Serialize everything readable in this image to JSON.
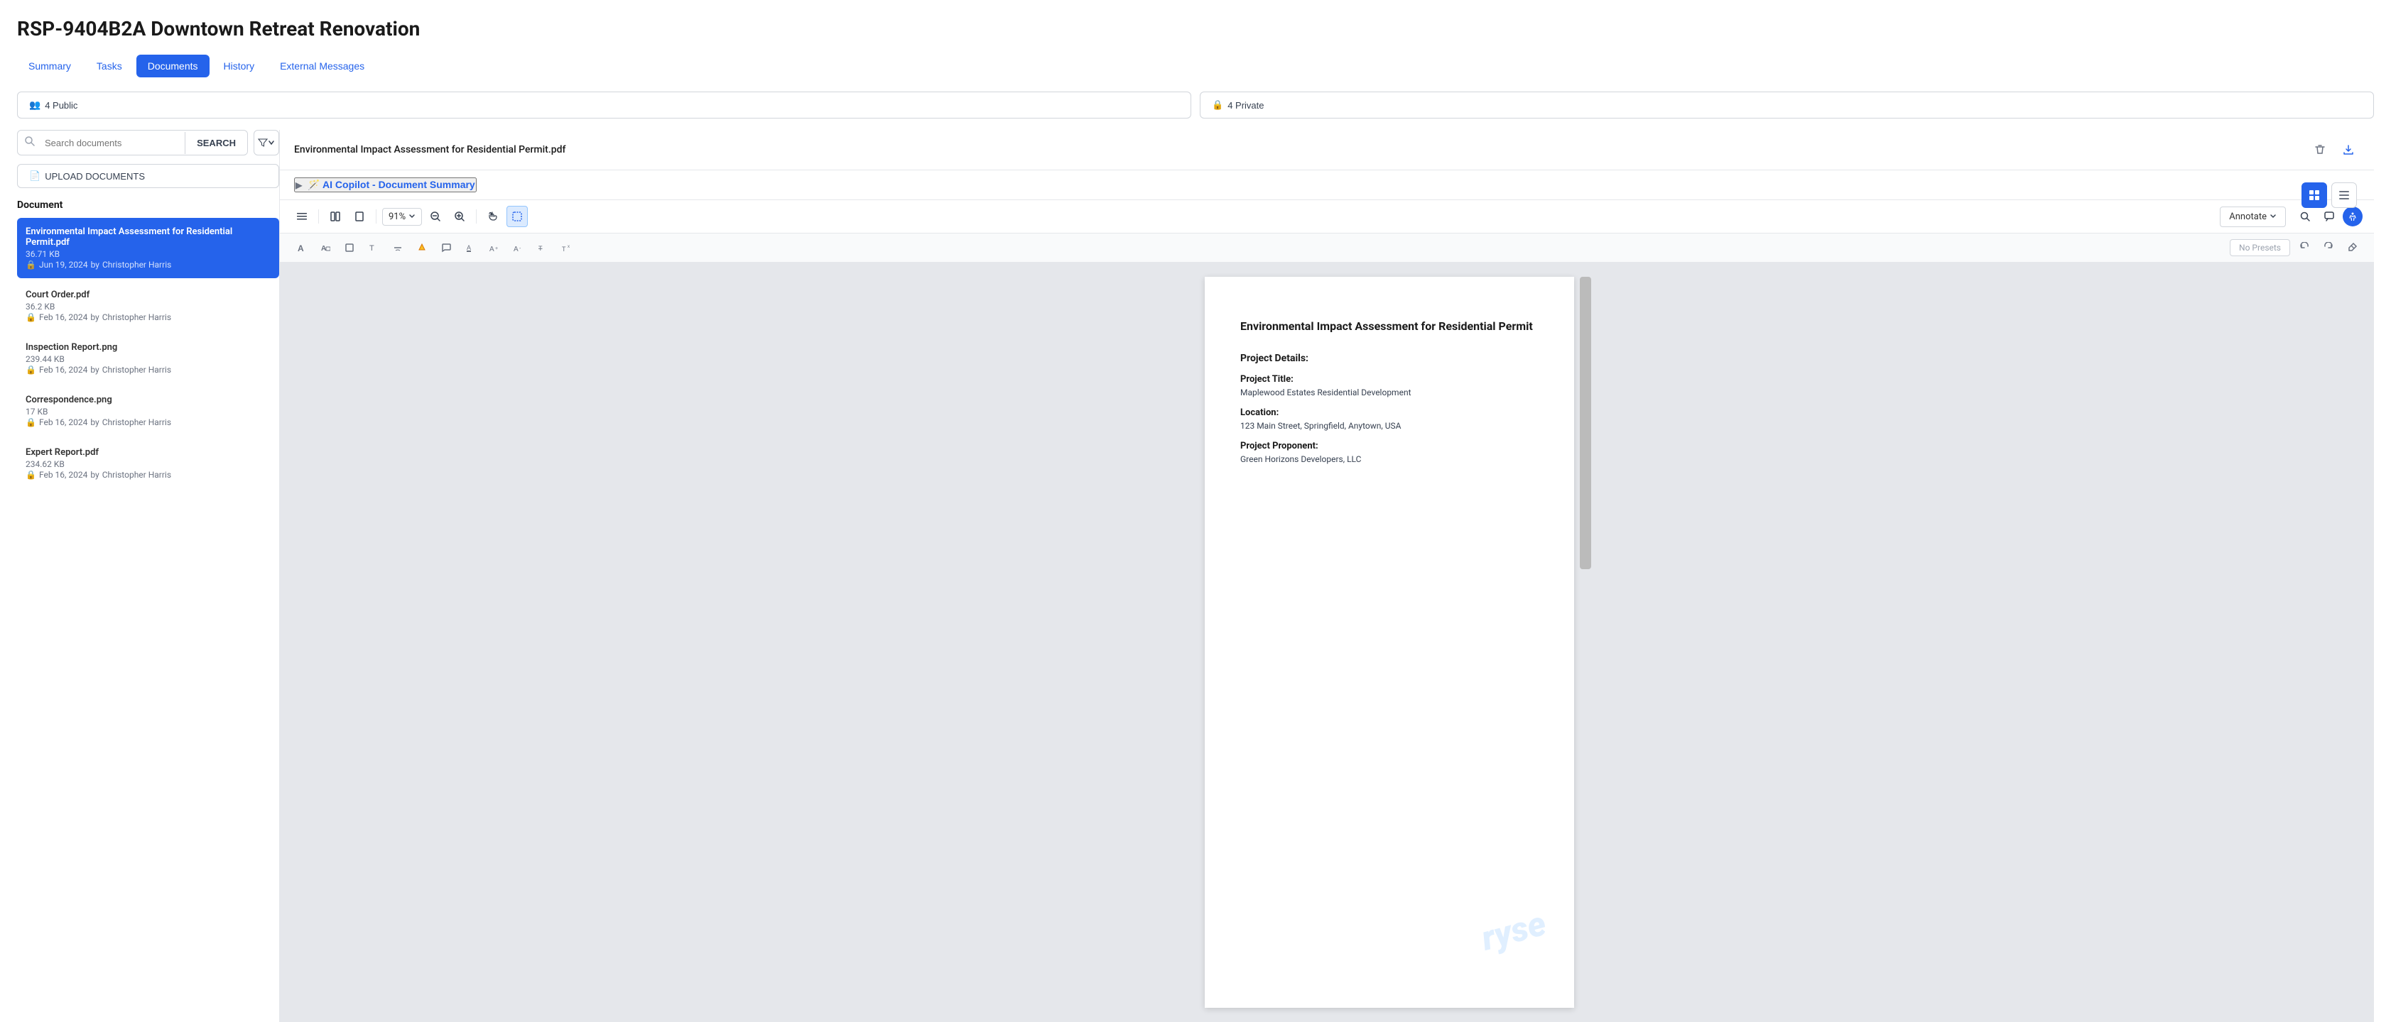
{
  "page": {
    "title": "RSP-9404B2A Downtown Retreat Renovation"
  },
  "tabs": [
    {
      "id": "summary",
      "label": "Summary",
      "active": false
    },
    {
      "id": "tasks",
      "label": "Tasks",
      "active": false
    },
    {
      "id": "documents",
      "label": "Documents",
      "active": true
    },
    {
      "id": "history",
      "label": "History",
      "active": false
    },
    {
      "id": "external-messages",
      "label": "External Messages",
      "active": false
    }
  ],
  "access_buttons": {
    "public": "4 Public",
    "private": "4 Private",
    "public_icon": "👥",
    "private_icon": "🔒"
  },
  "search": {
    "placeholder": "Search documents",
    "button_label": "SEARCH"
  },
  "upload": {
    "label": "UPLOAD DOCUMENTS"
  },
  "doc_list_header": "Document",
  "documents": [
    {
      "id": "doc1",
      "name": "Environmental Impact Assessment for Residential Permit.pdf",
      "size": "36.71 KB",
      "date": "Jun 19, 2024",
      "author": "Christopher Harris",
      "locked": true,
      "selected": true
    },
    {
      "id": "doc2",
      "name": "Court Order.pdf",
      "size": "36.2 KB",
      "date": "Feb 16, 2024",
      "author": "Christopher Harris",
      "locked": true,
      "selected": false
    },
    {
      "id": "doc3",
      "name": "Inspection Report.png",
      "size": "239.44 KB",
      "date": "Feb 16, 2024",
      "author": "Christopher Harris",
      "locked": true,
      "selected": false
    },
    {
      "id": "doc4",
      "name": "Correspondence.png",
      "size": "17 KB",
      "date": "Feb 16, 2024",
      "author": "Christopher Harris",
      "locked": true,
      "selected": false
    },
    {
      "id": "doc5",
      "name": "Expert Report.pdf",
      "size": "234.62 KB",
      "date": "Feb 16, 2024",
      "author": "Christopher Harris",
      "locked": true,
      "selected": false
    }
  ],
  "active_doc": {
    "filename": "Environmental Impact Assessment for Residential Permit.pdf",
    "ai_copilot_label": "🪄 AI Copilot - Document Summary",
    "zoom": "91%"
  },
  "pdf_content": {
    "title": "Environmental Impact Assessment for Residential Permit",
    "section1": "Project Details:",
    "field1_label": "Project Title:",
    "field1_value": "Maplewood Estates Residential Development",
    "field2_label": "Location:",
    "field2_value": "123 Main Street, Springfield, Anytown, USA",
    "field3_label": "Project Proponent:",
    "field3_value": "Green Horizons Developers, LLC",
    "watermark": "ryse"
  },
  "toolbar": {
    "annotate_label": "Annotate",
    "no_presets": "No Presets"
  }
}
